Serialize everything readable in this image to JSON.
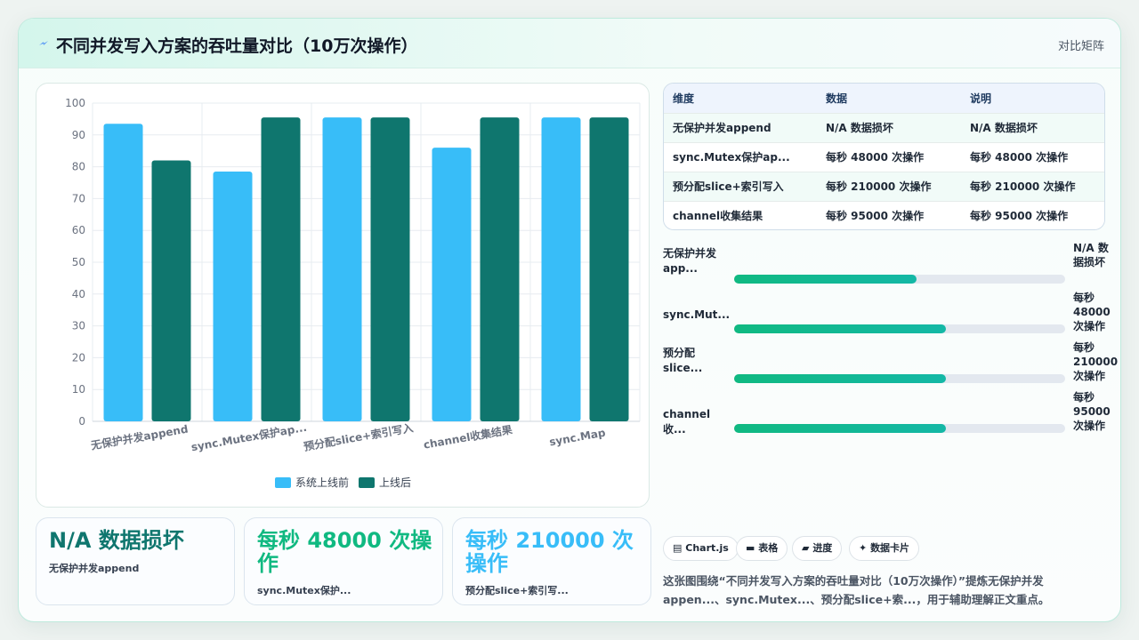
{
  "header": {
    "title": "不同并发写入方案的吞吐量对比（10万次操作）",
    "tag": "对比矩阵"
  },
  "colors": {
    "before": "#38bdf8",
    "after": "#0f766e",
    "accent": "#10b981",
    "stat1": "#0f766e",
    "stat2": "#10b981",
    "stat3": "#38bdf8"
  },
  "chart_data": {
    "type": "bar",
    "categories": [
      "无保护并发append",
      "sync.Mutex保护ap...",
      "预分配slice+索引写入",
      "channel收集结果",
      "sync.Map"
    ],
    "series": [
      {
        "name": "系统上线前",
        "values": [
          93.5,
          78.5,
          95.5,
          86,
          95.5
        ]
      },
      {
        "name": "上线后",
        "values": [
          82,
          95.5,
          95.5,
          95.5,
          95.5
        ]
      }
    ],
    "yticks": [
      "100",
      "90",
      "80",
      "70",
      "60",
      "50",
      "40",
      "30",
      "20",
      "10",
      "0"
    ],
    "ylim": [
      0,
      100
    ],
    "grid": true,
    "legend": "bottom"
  },
  "table": {
    "headers": [
      "维度",
      "数据",
      "说明"
    ],
    "rows": [
      [
        "无保护并发append",
        "N/A 数据损坏",
        "N/A 数据损坏"
      ],
      [
        "sync.Mutex保护ap...",
        "每秒 48000 次操作",
        "每秒 48000 次操作"
      ],
      [
        "预分配slice+索引写入",
        "每秒 210000 次操作",
        "每秒 210000 次操作"
      ],
      [
        "channel收集结果",
        "每秒 95000 次操作",
        "每秒 95000 次操作"
      ]
    ]
  },
  "progress": [
    {
      "label": "无保护并发app...",
      "value": "N/A 数据损坏",
      "fill": 0.55
    },
    {
      "label": "sync.Mut...",
      "value": "每秒 48000 次操作",
      "fill": 0.64
    },
    {
      "label": "预分配 slice...",
      "value": "每秒 210000 次操作",
      "fill": 0.64
    },
    {
      "label": "channel收...",
      "value": "每秒 95000 次操作",
      "fill": 0.64
    }
  ],
  "stats": [
    {
      "value": "N/A 数据损坏",
      "label": "无保护并发append"
    },
    {
      "value": "每秒 48000 次操作",
      "label": "sync.Mutex保护..."
    },
    {
      "value": "每秒 210000 次操作",
      "label": "预分配slice+索引写..."
    }
  ],
  "chips": [
    {
      "icon": "chart-icon",
      "glyph": "▤",
      "label": "Chart.js"
    },
    {
      "icon": "table-icon",
      "glyph": "▬",
      "label": "表格"
    },
    {
      "icon": "progress-icon",
      "glyph": "▰",
      "label": "进度"
    },
    {
      "icon": "sparkle-icon",
      "glyph": "✦",
      "label": "数据卡片"
    }
  ],
  "note": "这张图围绕“不同并发写入方案的吞吐量对比（10万次操作）”提炼无保护并发appen...、sync.Mutex...、预分配slice+索...，用于辅助理解正文重点。"
}
